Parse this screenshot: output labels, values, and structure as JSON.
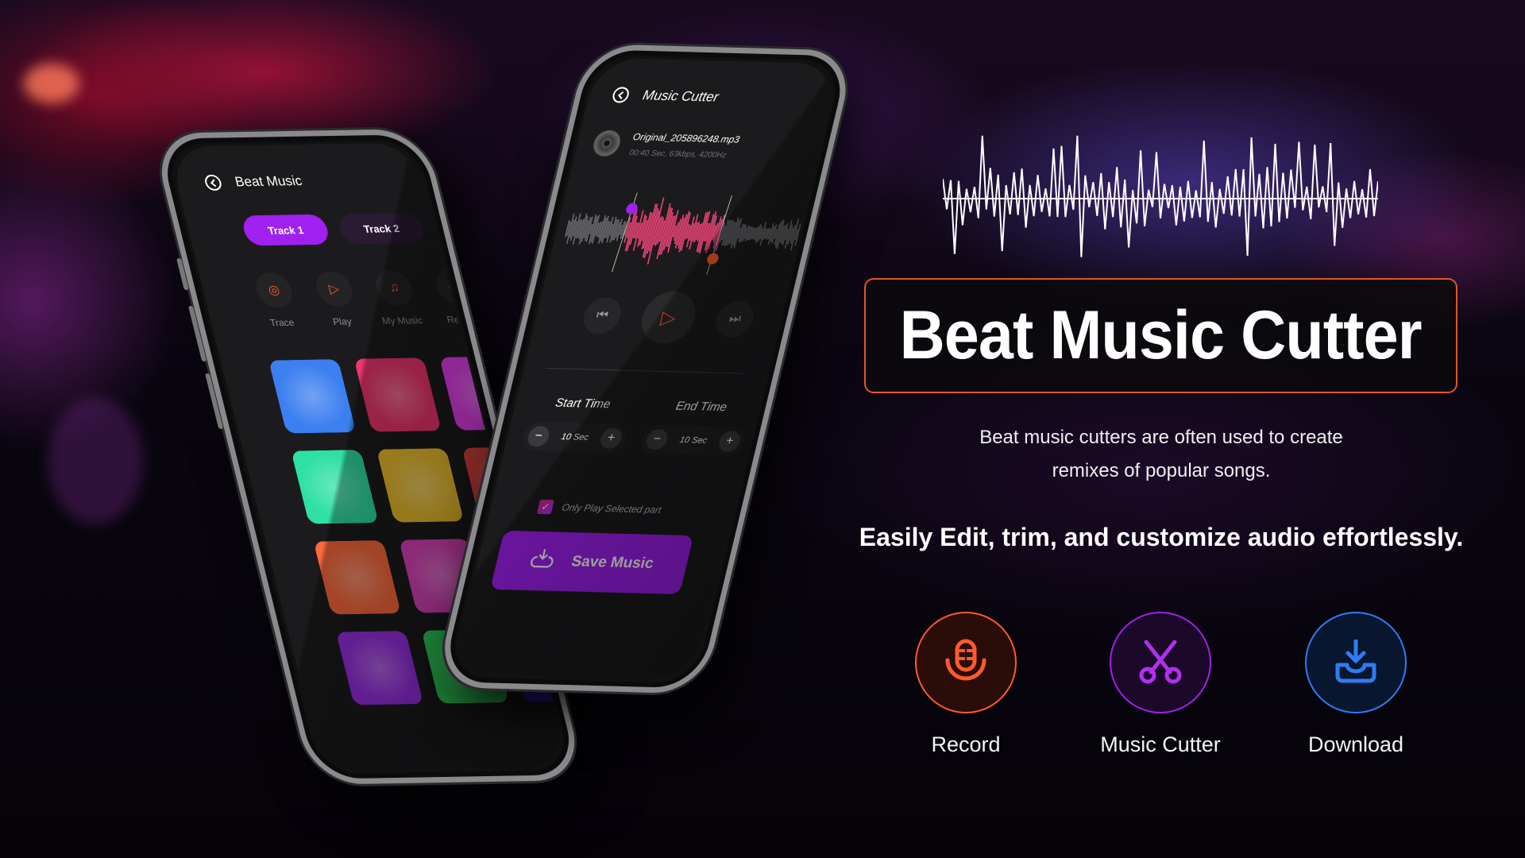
{
  "colors": {
    "accent_purple": "#a020f0",
    "accent_orange": "#ff5a2a",
    "title_border": "#e0562a",
    "record": "#ff5a2a",
    "cutter": "#a020f0",
    "download": "#2f7cf0"
  },
  "beat_music_app": {
    "title": "Beat Music",
    "back_icon": "back-circle-icon",
    "tabs": [
      {
        "label": "Track 1",
        "active": true
      },
      {
        "label": "Track 2",
        "active": false
      }
    ],
    "tools": [
      {
        "label": "Trace",
        "icon": "vinyl-icon",
        "glyph": "◎"
      },
      {
        "label": "Play",
        "icon": "play-circle-icon",
        "glyph": "▷"
      },
      {
        "label": "My Music",
        "icon": "playlist-icon",
        "glyph": "♫"
      },
      {
        "label": "Record",
        "icon": "microphone-icon",
        "glyph": "🎙"
      }
    ],
    "pads": [
      "#3b7ff0",
      "#f0356f",
      "#e63ef0",
      "#2fe0a5",
      "#f0c12e",
      "#e0443f",
      "#ff6a3d",
      "#e044c0",
      "#2faa6a",
      "#9a30e6",
      "#2fd45a",
      "#3a20c8"
    ]
  },
  "music_cutter_app": {
    "title": "Music Cutter",
    "file_name": "Original_205896248.mp3",
    "file_meta": "00:40 Sec, 63kbps, 4200Hz",
    "controls": {
      "prev_glyph": "⏮",
      "play_glyph": "▷",
      "next_glyph": "⏭"
    },
    "start_time": {
      "label": "Start Time",
      "value": "10 Sec"
    },
    "end_time": {
      "label": "End Time",
      "value": "10 Sec"
    },
    "minus": "−",
    "plus": "+",
    "only_play_selected": {
      "label": "Only Play Selected part",
      "checked": true,
      "check_glyph": "✓"
    },
    "save_button": "Save Music"
  },
  "marketing": {
    "title": "Beat Music Cutter",
    "description_line1": "Beat music cutters are often used to create",
    "description_line2": "remixes of popular songs.",
    "tagline": "Easily Edit, trim, and customize audio effortlessly.",
    "features": [
      {
        "label": "Record",
        "icon": "microphone-icon"
      },
      {
        "label": "Music Cutter",
        "icon": "scissors-icon"
      },
      {
        "label": "Download",
        "icon": "download-tray-icon"
      }
    ]
  }
}
